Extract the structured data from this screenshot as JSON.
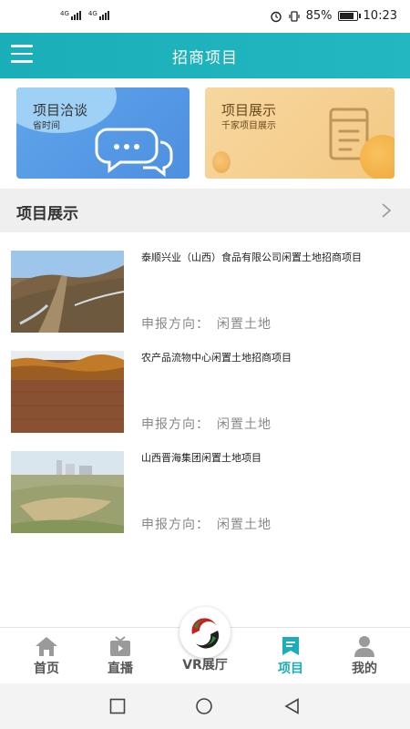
{
  "status_bar": {
    "network_1": "4G",
    "network_2": "4G",
    "battery": "85%",
    "battery_level": 0.85,
    "time": "10:23"
  },
  "header": {
    "title": "招商项目"
  },
  "banners": [
    {
      "title": "项目洽谈",
      "subtitle": "省时间"
    },
    {
      "title": "项目展示",
      "subtitle": "千家项目展示"
    }
  ],
  "section": {
    "title": "项目展示"
  },
  "projects": [
    {
      "title": "泰顺兴业（山西）食品有限公司闲置土地招商项目",
      "meta_label": "申报方向：",
      "meta_value": "闲置土地"
    },
    {
      "title": "农产品流物中心闲置土地招商项目",
      "meta_label": "申报方向：",
      "meta_value": "闲置土地"
    },
    {
      "title": "山西晋海集团闲置土地项目",
      "meta_label": "申报方向：",
      "meta_value": "闲置土地"
    }
  ],
  "tabs": [
    {
      "label": "首页",
      "icon": "home-icon"
    },
    {
      "label": "直播",
      "icon": "tv-icon"
    },
    {
      "label": "VR展厅",
      "icon": "vr-logo"
    },
    {
      "label": "项目",
      "icon": "project-icon",
      "active": true
    },
    {
      "label": "我的",
      "icon": "user-icon"
    }
  ],
  "colors": {
    "accent": "#1aaeb9",
    "banner_talk": "#5ea6ea",
    "banner_show": "#f3c983"
  }
}
